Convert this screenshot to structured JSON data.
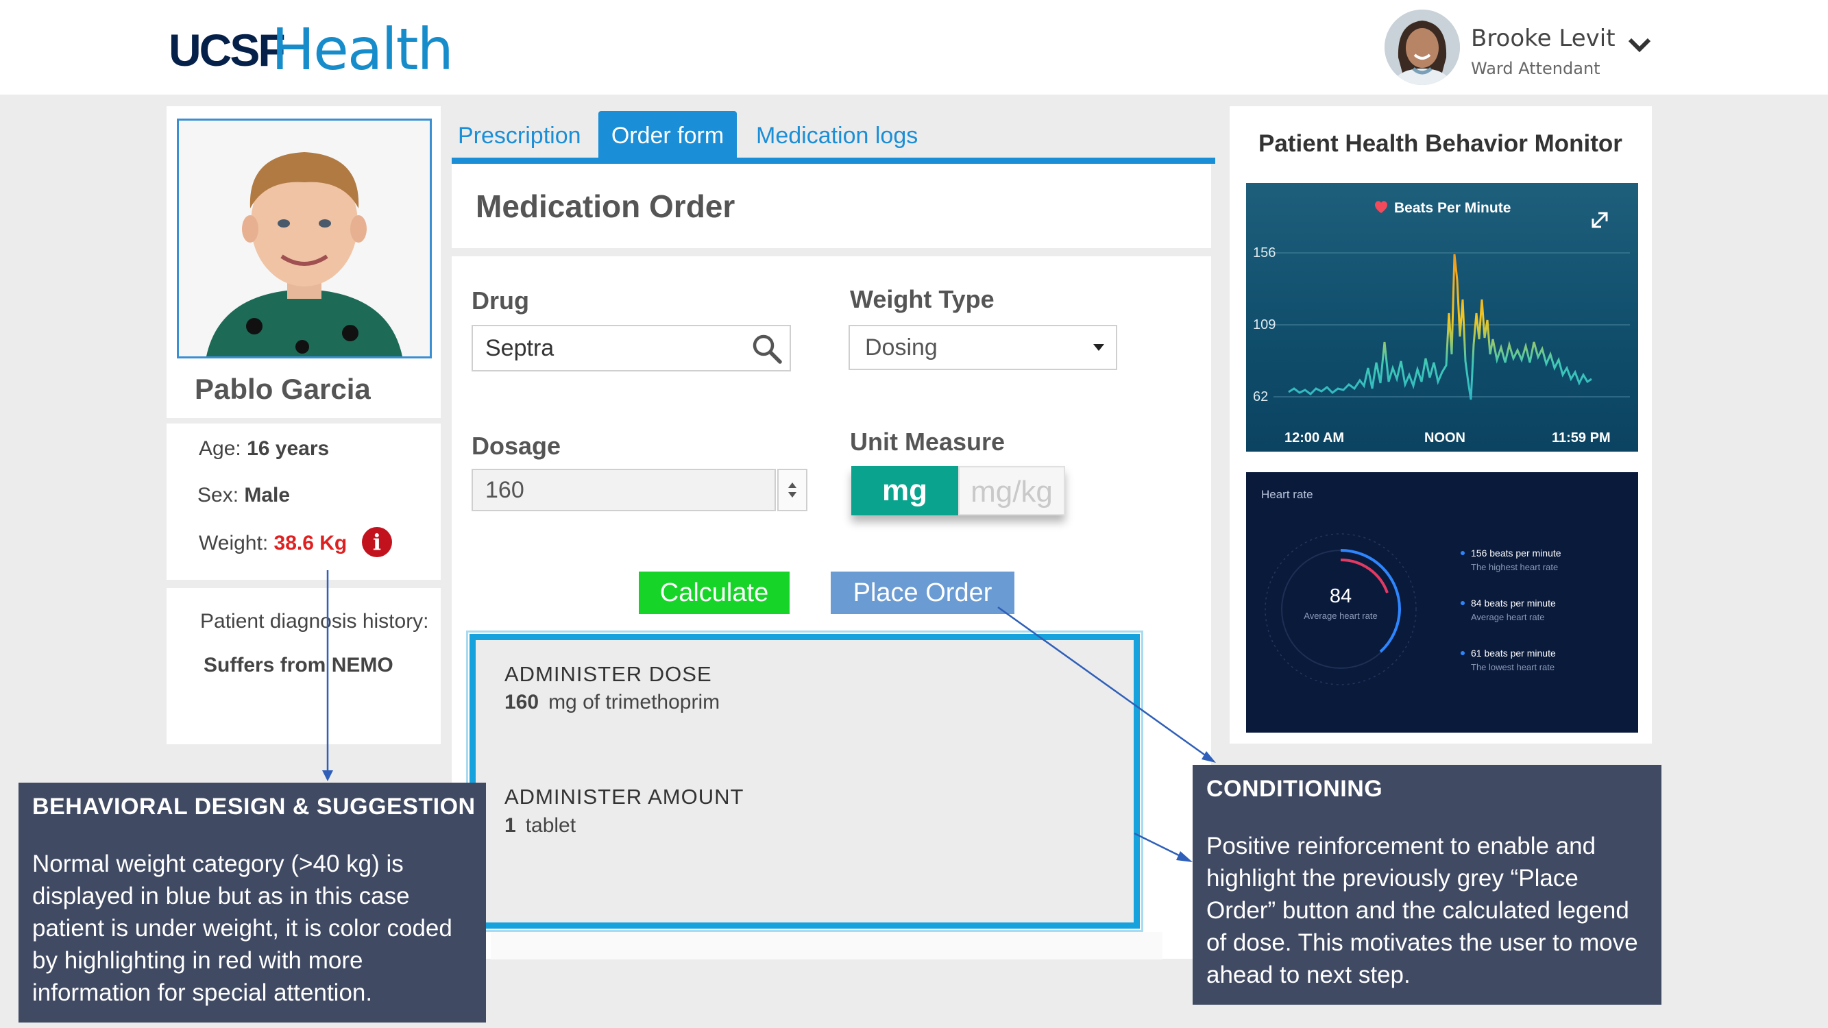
{
  "header": {
    "logo_ucsf": "UCSF",
    "logo_health": "Health",
    "user_name": "Brooke Levit",
    "user_role": "Ward Attendant"
  },
  "patient": {
    "name": "Pablo Garcia",
    "age_label": "Age:",
    "age_value": "16 years",
    "sex_label": "Sex:",
    "sex_value": "Male",
    "weight_label": "Weight:",
    "weight_value": "38.6 Kg",
    "history_label": "Patient diagnosis history:",
    "history_value": "Suffers from NEMO"
  },
  "tabs": [
    {
      "label": "Prescription",
      "active": false
    },
    {
      "label": "Order form",
      "active": true
    },
    {
      "label": "Medication logs",
      "active": false
    }
  ],
  "form": {
    "title": "Medication Order",
    "drug_label": "Drug",
    "drug_value": "Septra",
    "weight_type_label": "Weight Type",
    "weight_type_value": "Dosing",
    "dosage_label": "Dosage",
    "dosage_value": "160",
    "unit_label": "Unit Measure",
    "unit_options": [
      "mg",
      "mg/kg"
    ],
    "unit_selected": "mg",
    "calculate_label": "Calculate",
    "place_order_label": "Place Order"
  },
  "result": {
    "dose_title": "ADMINISTER DOSE",
    "dose_amount": "160",
    "dose_text": "mg of trimethoprim",
    "amount_title": "ADMINISTER AMOUNT",
    "amount_value": "1",
    "amount_text": "tablet"
  },
  "monitor": {
    "title": "Patient Health Behavior Monitor",
    "bpm": {
      "legend": "Beats Per Minute",
      "y_ticks": [
        "156",
        "109",
        "62"
      ],
      "x_ticks": [
        "12:00 AM",
        "NOON",
        "11:59 PM"
      ]
    },
    "heart_rate": {
      "title": "Heart rate",
      "value": "84",
      "value_label": "Average heart rate",
      "stats": [
        {
          "value": "156 beats per minute",
          "desc": "The highest heart rate"
        },
        {
          "value": "84 beats per minute",
          "desc": "Average heart rate"
        },
        {
          "value": "61 beats per minute",
          "desc": "The lowest heart rate"
        }
      ]
    }
  },
  "annotations": {
    "left_title": "BEHAVIORAL DESIGN & SUGGESTION",
    "left_body": "Normal weight category (>40 kg) is displayed in blue but as in this case patient is under weight, it is color coded by highlighting in red with more information for special attention.",
    "right_title": "CONDITIONING",
    "right_body": "Positive reinforcement to enable and highlight the previously grey “Place Order” button and the calculated legend of dose. This motivates the user to move ahead to next step."
  },
  "colors": {
    "brand_blue": "#1a8ed6",
    "ucsf_navy": "#052049",
    "underweight_red": "#e02020",
    "calculate_green": "#17d528",
    "place_order_blue": "#6a9bd3",
    "unit_selected_teal": "#0aa48e",
    "annotation_bg": "#404a63"
  }
}
